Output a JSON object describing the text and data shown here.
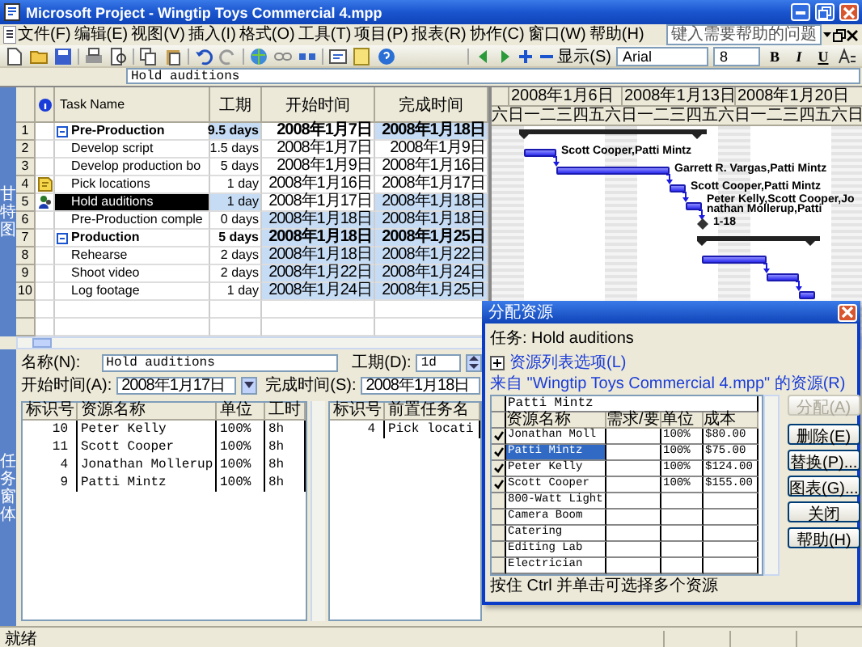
{
  "window": {
    "title": "Microsoft Project - Wingtip Toys Commercial 4.mpp"
  },
  "menu": [
    "文件(F)",
    "编辑(E)",
    "视图(V)",
    "插入(I)",
    "格式(O)",
    "工具(T)",
    "项目(P)",
    "报表(R)",
    "协作(C)",
    "窗口(W)",
    "帮助(H)"
  ],
  "help_search": {
    "placeholder": "键入需要帮助的问题"
  },
  "toolbar": {
    "view_button": "显示(S)",
    "font": "Arial",
    "font_size": "8",
    "format_buttons": [
      "B",
      "I",
      "U"
    ]
  },
  "entry_bar": {
    "value": "Hold auditions"
  },
  "gantt": {
    "view_label": "甘特图",
    "columns": [
      "Task Name",
      "工期",
      "开始时间",
      "完成时间"
    ],
    "weeks": [
      "2008年1月6日",
      "2008年1月13日",
      "2008年1月20日"
    ],
    "days": [
      "六",
      "日",
      "一",
      "二",
      "三",
      "四",
      "五",
      "六",
      "日",
      "一",
      "二",
      "三",
      "四",
      "五",
      "六",
      "日",
      "一",
      "二",
      "三",
      "四",
      "五",
      "六",
      "日"
    ],
    "tasks": [
      {
        "id": "1",
        "name": "Pre-Production",
        "kind": "summary",
        "expanded": true,
        "duration": {
          "text": "9.5 days",
          "changed": true
        },
        "start": {
          "text": "2008年1月7日",
          "changed": false
        },
        "finish": {
          "text": "2008年1月18日",
          "changed": true
        },
        "selected": false
      },
      {
        "id": "2",
        "name": "Develop script",
        "kind": "task",
        "duration": {
          "text": "1.5 days",
          "changed": false
        },
        "start": {
          "text": "2008年1月7日",
          "changed": false
        },
        "finish": {
          "text": "2008年1月9日",
          "changed": false
        },
        "bar_label": "Scott Cooper,Patti Mintz",
        "selected": false
      },
      {
        "id": "3",
        "name": "Develop production bo",
        "kind": "task",
        "duration": {
          "text": "5 days",
          "changed": false
        },
        "start": {
          "text": "2008年1月9日",
          "changed": false
        },
        "finish": {
          "text": "2008年1月16日",
          "changed": false
        },
        "bar_label": "Garrett R. Vargas,Patti Mintz",
        "selected": false
      },
      {
        "id": "4",
        "name": "Pick locations",
        "kind": "task",
        "indicator": {
          "kind": "note"
        },
        "duration": {
          "text": "1 day",
          "changed": false
        },
        "start": {
          "text": "2008年1月16日",
          "changed": false
        },
        "finish": {
          "text": "2008年1月17日",
          "changed": false
        },
        "bar_label": "Scott Cooper,Patti Mintz",
        "selected": false
      },
      {
        "id": "5",
        "name": "Hold auditions",
        "kind": "task",
        "indicator": {
          "kind": "resource"
        },
        "duration": {
          "text": "1 day",
          "changed": true
        },
        "start": {
          "text": "2008年1月17日",
          "changed": false
        },
        "finish": {
          "text": "2008年1月18日",
          "changed": true
        },
        "bar_label": "Peter Kelly,Scott Cooper,Jonathan Mollerup,Patti",
        "selected": true
      },
      {
        "id": "6",
        "name": "Pre-Production comple",
        "kind": "milestone",
        "duration": {
          "text": "0 days",
          "changed": false
        },
        "start": {
          "text": "2008年1月18日",
          "changed": true
        },
        "finish": {
          "text": "2008年1月18日",
          "changed": true
        },
        "bar_label": "1-18",
        "selected": false
      },
      {
        "id": "7",
        "name": "Production",
        "kind": "summary",
        "expanded": true,
        "duration": {
          "text": "5 days",
          "changed": false
        },
        "start": {
          "text": "2008年1月18日",
          "changed": true
        },
        "finish": {
          "text": "2008年1月25日",
          "changed": true
        },
        "selected": false
      },
      {
        "id": "8",
        "name": "Rehearse",
        "kind": "task",
        "duration": {
          "text": "2 days",
          "changed": false
        },
        "start": {
          "text": "2008年1月18日",
          "changed": true
        },
        "finish": {
          "text": "2008年1月22日",
          "changed": true
        },
        "selected": false
      },
      {
        "id": "9",
        "name": "Shoot video",
        "kind": "task",
        "duration": {
          "text": "2 days",
          "changed": false
        },
        "start": {
          "text": "2008年1月22日",
          "changed": true
        },
        "finish": {
          "text": "2008年1月24日",
          "changed": true
        },
        "selected": false
      },
      {
        "id": "10",
        "name": "Log footage",
        "kind": "task",
        "duration": {
          "text": "1 day",
          "changed": false
        },
        "start": {
          "text": "2008年1月24日",
          "changed": true
        },
        "finish": {
          "text": "2008年1月25日",
          "changed": true
        },
        "selected": false
      }
    ]
  },
  "task_form": {
    "view_label": "任务窗体",
    "name_label": "名称(N):",
    "name": "Hold auditions",
    "duration_label": "工期(D):",
    "duration": "1d",
    "start_label": "开始时间(A):",
    "start": "2008年1月17日",
    "finish_label": "完成时间(S):",
    "finish": "2008年1月18日",
    "resources": {
      "columns": [
        "标识号",
        "资源名称",
        "单位",
        "工时"
      ],
      "rows": [
        [
          "10",
          "Peter Kelly",
          "100%",
          "8h"
        ],
        [
          "11",
          "Scott Cooper",
          "100%",
          "8h"
        ],
        [
          "4",
          "Jonathan Mollerup",
          "100%",
          "8h"
        ],
        [
          "9",
          "Patti Mintz",
          "100%",
          "8h"
        ]
      ]
    },
    "predecessors": {
      "columns": [
        "标识号",
        "前置任务名"
      ],
      "rows": [
        [
          "4",
          "Pick locati"
        ]
      ]
    }
  },
  "assign_dialog": {
    "title": "分配资源",
    "task_label": "任务: Hold auditions",
    "options_toggle": "资源列表选项(L)",
    "options_expanded": false,
    "source_label": "来自 \"Wingtip Toys Commercial 4.mpp\" 的资源(R)",
    "filter_value": "Patti Mintz",
    "columns": [
      "资源名称",
      "需求/要",
      "单位",
      "成本"
    ],
    "resources": [
      {
        "name": "Jonathan Moll",
        "units": "100%",
        "cost": "$80.00",
        "assigned": true,
        "selected": false
      },
      {
        "name": "Patti Mintz",
        "units": "100%",
        "cost": "$75.00",
        "assigned": true,
        "selected": true
      },
      {
        "name": "Peter Kelly",
        "units": "100%",
        "cost": "$124.00",
        "assigned": true,
        "selected": false
      },
      {
        "name": "Scott Cooper",
        "units": "100%",
        "cost": "$155.00",
        "assigned": true,
        "selected": false
      },
      {
        "name": "800-Watt Light",
        "assigned": false,
        "selected": false
      },
      {
        "name": "Camera Boom",
        "assigned": false,
        "selected": false
      },
      {
        "name": "Catering",
        "assigned": false,
        "selected": false
      },
      {
        "name": "Editing Lab",
        "assigned": false,
        "selected": false
      },
      {
        "name": "Electrician",
        "assigned": false,
        "selected": false
      }
    ],
    "buttons": [
      {
        "label": "分配(A)",
        "disabled": true
      },
      {
        "label": "删除(E)",
        "disabled": false
      },
      {
        "label": "替换(P)...",
        "disabled": false
      },
      {
        "label": "图表(G)...",
        "disabled": false
      },
      {
        "label": "关闭",
        "disabled": false
      },
      {
        "label": "帮助(H)",
        "disabled": false
      }
    ],
    "hint": "按住 Ctrl 并单击可选择多个资源"
  },
  "status_bar": {
    "text": "就绪"
  }
}
